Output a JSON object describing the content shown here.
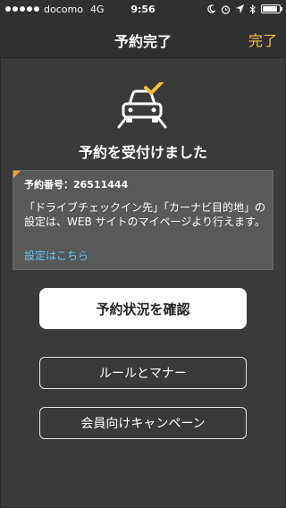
{
  "status_bar": {
    "carrier": "docomo",
    "network": "4G",
    "time": "9:56"
  },
  "nav": {
    "title": "予約完了",
    "done_label": "完了"
  },
  "headline": "予約を受付けました",
  "info": {
    "booking_label": "予約番号：",
    "booking_number": "26511444",
    "body": "「ドライブチェックイン先」「カーナビ目的地」の設定は、WEB サイトのマイページより行えます。",
    "link_label": "設定はこちら"
  },
  "buttons": {
    "confirm": "予約状況を確認",
    "rules": "ルールとマナー",
    "campaign": "会員向けキャンペーン"
  },
  "colors": {
    "accent": "#f5c33b",
    "link": "#5ac8fa",
    "background": "#3a3a3a",
    "info_box": "#595959",
    "corner_marker": "#f5a623"
  },
  "icons": [
    "car-check-icon",
    "moon-icon",
    "location-icon",
    "bluetooth-icon",
    "battery-icon",
    "signal-icon"
  ]
}
